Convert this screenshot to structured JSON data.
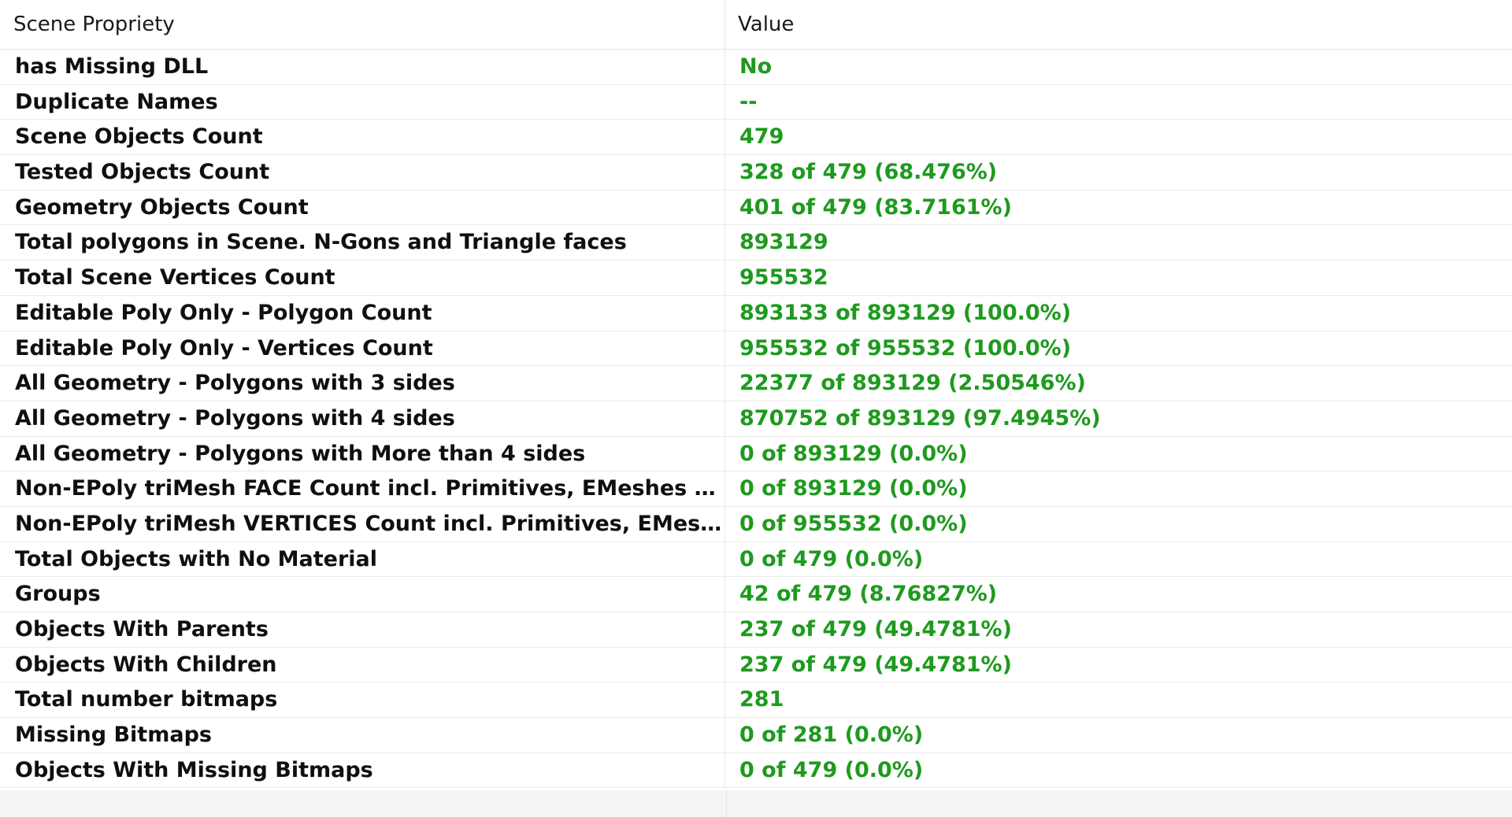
{
  "columns": {
    "property_header": "Scene Propriety",
    "value_header": "Value"
  },
  "colors": {
    "value_text": "#1e9a1e",
    "name_text": "#0f0f0f",
    "header_text": "#1a1a1a",
    "grid_line": "#eaeaea"
  },
  "rows": [
    {
      "name": "has Missing DLL",
      "value": "No"
    },
    {
      "name": "Duplicate Names",
      "value": "--"
    },
    {
      "name": "Scene Objects Count",
      "value": "479"
    },
    {
      "name": "Tested Objects Count",
      "value": "328 of 479 (68.476%)"
    },
    {
      "name": "Geometry Objects Count",
      "value": "401 of 479 (83.7161%)"
    },
    {
      "name": "Total polygons in Scene. N-Gons and Triangle faces",
      "value": "893129"
    },
    {
      "name": "Total Scene Vertices Count",
      "value": "955532"
    },
    {
      "name": "Editable Poly Only - Polygon Count",
      "value": "893133 of 893129 (100.0%)"
    },
    {
      "name": "Editable Poly Only - Vertices Count",
      "value": "955532 of 955532 (100.0%)"
    },
    {
      "name": "All Geometry - Polygons with 3 sides",
      "value": "22377 of 893129 (2.50546%)"
    },
    {
      "name": "All Geometry - Polygons with 4 sides",
      "value": "870752 of 893129 (97.4945%)"
    },
    {
      "name": "All Geometry - Polygons with More than 4 sides",
      "value": "0 of 893129 (0.0%)"
    },
    {
      "name": "Non-EPoly triMesh FACE Count incl. Primitives, EMeshes etc...",
      "value": "0 of 893129 (0.0%)"
    },
    {
      "name": "Non-EPoly triMesh VERTICES Count incl. Primitives, EMeshes ...",
      "value": "0 of 955532 (0.0%)"
    },
    {
      "name": "Total Objects with No Material",
      "value": "0 of 479 (0.0%)"
    },
    {
      "name": "Groups",
      "value": "42 of 479 (8.76827%)"
    },
    {
      "name": "Objects With Parents",
      "value": "237 of 479 (49.4781%)"
    },
    {
      "name": "Objects With Children",
      "value": "237 of 479 (49.4781%)"
    },
    {
      "name": "Total number bitmaps",
      "value": "281"
    },
    {
      "name": "Missing Bitmaps",
      "value": "0 of 281 (0.0%)"
    },
    {
      "name": "Objects With Missing Bitmaps",
      "value": "0 of 479 (0.0%)"
    }
  ]
}
